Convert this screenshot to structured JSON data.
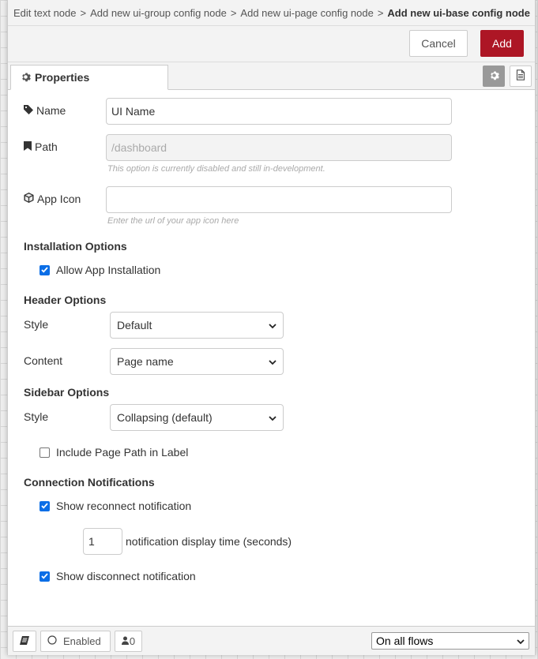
{
  "breadcrumb": {
    "items": [
      "Edit text node",
      "Add new ui-group config node",
      "Add new ui-page config node"
    ],
    "current": "Add new ui-base config node",
    "separator": ">"
  },
  "toolbar": {
    "cancel_label": "Cancel",
    "add_label": "Add"
  },
  "tabs": {
    "properties_label": "Properties"
  },
  "form": {
    "name_label": "Name",
    "name_value": "UI Name",
    "path_label": "Path",
    "path_placeholder": "/dashboard",
    "path_hint": "This option is currently disabled and still in-development.",
    "app_icon_label": "App Icon",
    "app_icon_value": "",
    "app_icon_hint": "Enter the url of your app icon here"
  },
  "installation": {
    "title": "Installation Options",
    "allow_install_label": "Allow App Installation",
    "allow_install_checked": true
  },
  "header_options": {
    "title": "Header Options",
    "style_label": "Style",
    "style_value": "Default",
    "content_label": "Content",
    "content_value": "Page name"
  },
  "sidebar_options": {
    "title": "Sidebar Options",
    "style_label": "Style",
    "style_value": "Collapsing (default)",
    "include_path_label": "Include Page Path in Label",
    "include_path_checked": false
  },
  "notifications": {
    "title": "Connection Notifications",
    "reconnect_label": "Show reconnect notification",
    "reconnect_checked": true,
    "display_time_value": "1",
    "display_time_label": "notification display time (seconds)",
    "disconnect_label": "Show disconnect notification",
    "disconnect_checked": true
  },
  "footer": {
    "enabled_label": "Enabled",
    "user_count": "0",
    "flows_value": "On all flows"
  },
  "colors": {
    "accent": "#ad1625",
    "checkbox": "#0b6ee6"
  }
}
